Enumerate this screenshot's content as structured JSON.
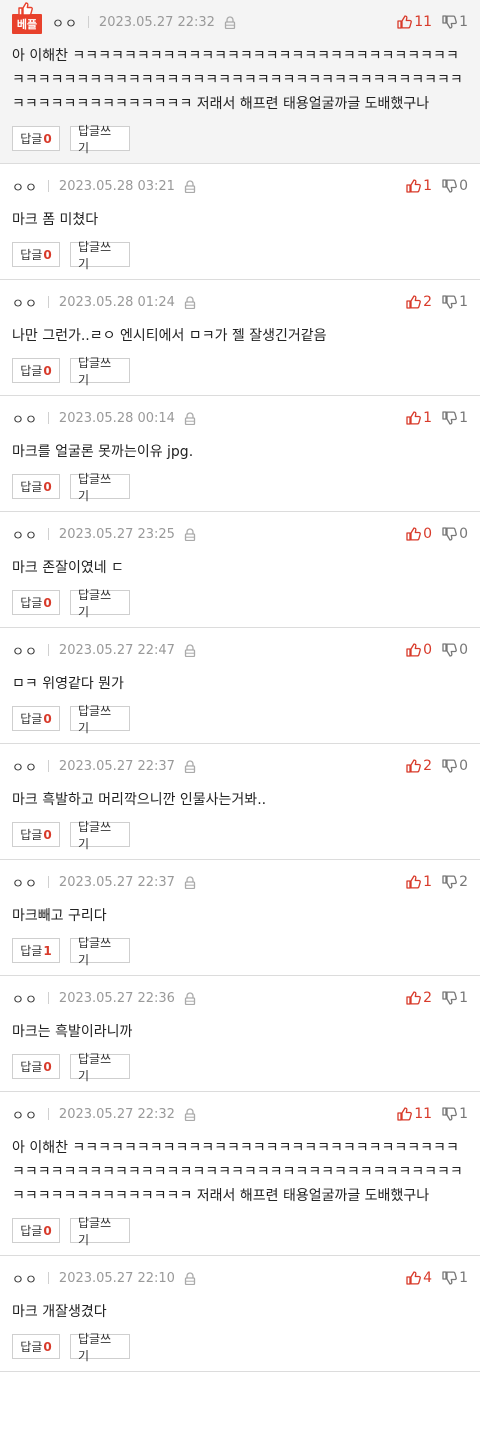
{
  "best_badge": "베플",
  "reply_label": "답글",
  "write_label": "답글쓰기",
  "comments": [
    {
      "nick": "ㅇㅇ",
      "date": "2023.05.27 22:32",
      "up": "11",
      "down": "1",
      "text": "아 이해찬 ㅋㅋㅋㅋㅋㅋㅋㅋㅋㅋㅋㅋㅋㅋㅋㅋㅋㅋㅋㅋㅋㅋㅋㅋㅋㅋㅋㅋㅋㅋㅋㅋㅋㅋㅋㅋㅋㅋㅋㅋㅋㅋㅋㅋㅋㅋㅋㅋㅋㅋㅋㅋㅋㅋㅋㅋㅋㅋㅋㅋㅋㅋㅋㅋㅋㅋㅋㅋㅋㅋㅋㅋㅋㅋㅋㅋㅋㅋㅋ 저래서 해프련 태용얼굴까글 도배했구나",
      "replies": "0",
      "best": true
    },
    {
      "nick": "ㅇㅇ",
      "date": "2023.05.28 03:21",
      "up": "1",
      "down": "0",
      "text": "마크 폼 미쳤다",
      "replies": "0"
    },
    {
      "nick": "ㅇㅇ",
      "date": "2023.05.28 01:24",
      "up": "2",
      "down": "1",
      "text": "나만 그런가..ㄹㅇ 엔시티에서 ㅁㅋ가 젤 잘생긴거같음",
      "replies": "0"
    },
    {
      "nick": "ㅇㅇ",
      "date": "2023.05.28 00:14",
      "up": "1",
      "down": "1",
      "text": "마크를 얼굴론 못까는이유 jpg.",
      "replies": "0"
    },
    {
      "nick": "ㅇㅇ",
      "date": "2023.05.27 23:25",
      "up": "0",
      "down": "0",
      "text": "마크 존잘이였네 ㄷ",
      "replies": "0"
    },
    {
      "nick": "ㅇㅇ",
      "date": "2023.05.27 22:47",
      "up": "0",
      "down": "0",
      "text": "ㅁㅋ 위영같다 뭔가",
      "replies": "0"
    },
    {
      "nick": "ㅇㅇ",
      "date": "2023.05.27 22:37",
      "up": "2",
      "down": "0",
      "text": "마크 흑발하고 머리깍으니깐 인물사는거봐..",
      "replies": "0"
    },
    {
      "nick": "ㅇㅇ",
      "date": "2023.05.27 22:37",
      "up": "1",
      "down": "2",
      "text": "마크빼고 구리다",
      "replies": "1"
    },
    {
      "nick": "ㅇㅇ",
      "date": "2023.05.27 22:36",
      "up": "2",
      "down": "1",
      "text": "마크는 흑발이라니까",
      "replies": "0"
    },
    {
      "nick": "ㅇㅇ",
      "date": "2023.05.27 22:32",
      "up": "11",
      "down": "1",
      "text": "아 이해찬 ㅋㅋㅋㅋㅋㅋㅋㅋㅋㅋㅋㅋㅋㅋㅋㅋㅋㅋㅋㅋㅋㅋㅋㅋㅋㅋㅋㅋㅋㅋㅋㅋㅋㅋㅋㅋㅋㅋㅋㅋㅋㅋㅋㅋㅋㅋㅋㅋㅋㅋㅋㅋㅋㅋㅋㅋㅋㅋㅋㅋㅋㅋㅋㅋㅋㅋㅋㅋㅋㅋㅋㅋㅋㅋㅋㅋㅋㅋㅋ 저래서 해프련 태용얼굴까글 도배했구나",
      "replies": "0"
    },
    {
      "nick": "ㅇㅇ",
      "date": "2023.05.27 22:10",
      "up": "4",
      "down": "1",
      "text": "마크 개잘생겼다",
      "replies": "0"
    }
  ],
  "colors": {
    "accent": "#d83a2a",
    "badge": "#e8412c",
    "muted": "#999999"
  }
}
